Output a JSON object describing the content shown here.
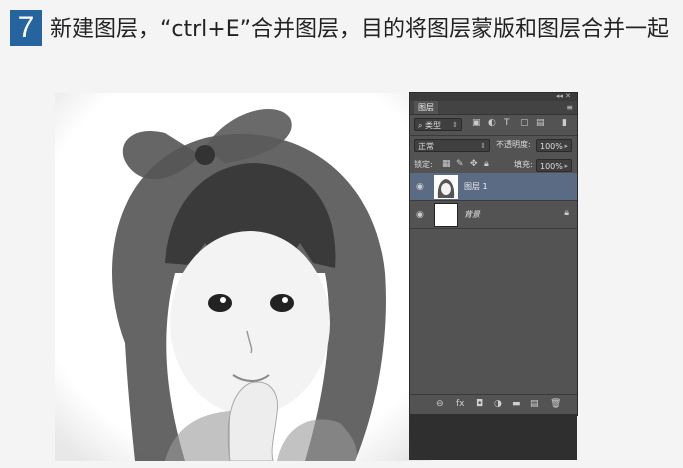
{
  "step": {
    "number": "7",
    "text": "新建图层，“ctrl+E”合并图层，目的将图层蒙版和图层合并一起"
  },
  "layers_panel": {
    "tab_title": "图层",
    "kind_filter": "类型",
    "blend_mode": "正常",
    "opacity_label": "不透明度:",
    "opacity_value": "100%",
    "lock_label": "锁定:",
    "fill_label": "填充:",
    "fill_value": "100%",
    "layers": [
      {
        "name": "图层 1",
        "selected": true,
        "visible": true
      },
      {
        "name": "背景",
        "selected": false,
        "visible": true,
        "locked": true
      }
    ],
    "colors": {
      "panel_bg": "#535353",
      "selected_row": "#5b6b84",
      "step_badge": "#25649f"
    }
  }
}
